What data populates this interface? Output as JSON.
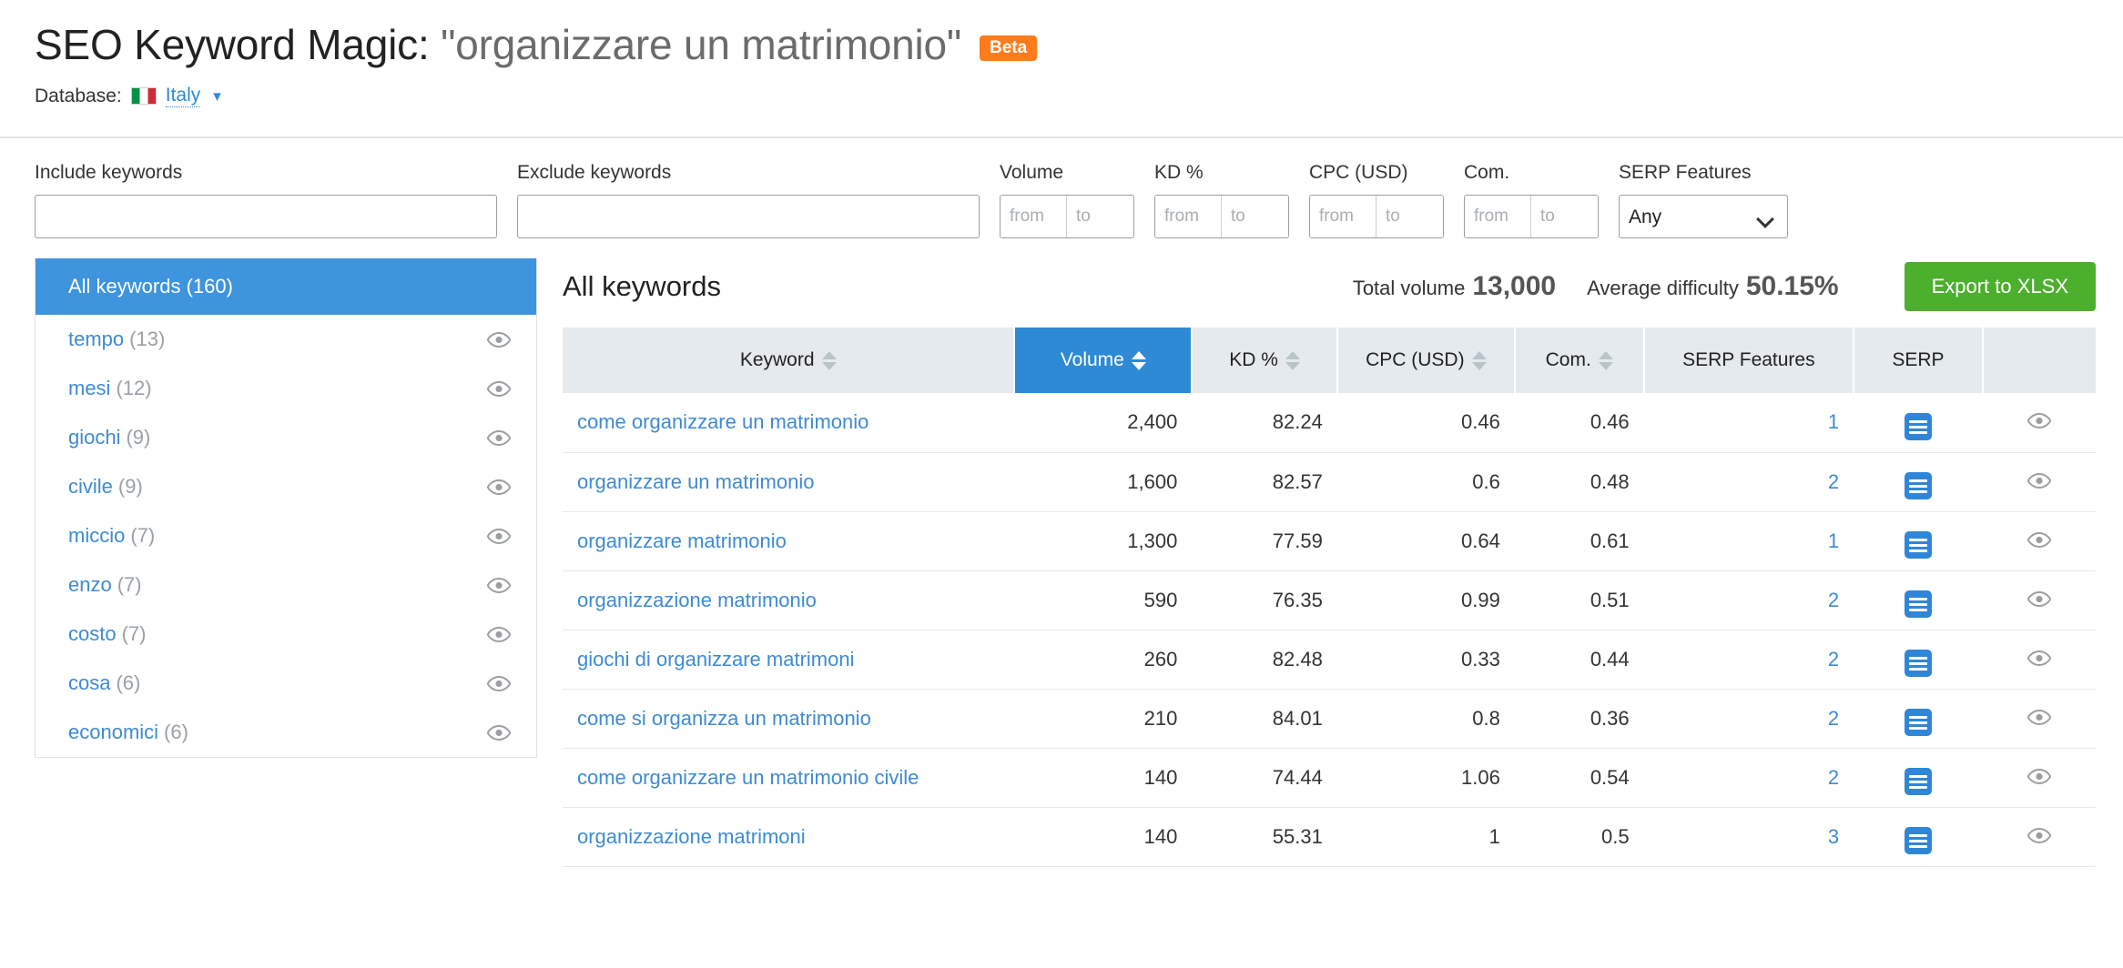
{
  "header": {
    "title_prefix": "SEO Keyword Magic: ",
    "title_query": "\"organizzare un matrimonio\"",
    "beta_label": "Beta",
    "database_label": "Database:",
    "database_value": "Italy",
    "database_flag": "italy-flag-icon",
    "caret_icon": "chevron-down-icon"
  },
  "filters": {
    "include": {
      "label": "Include keywords",
      "value": "",
      "placeholder": ""
    },
    "exclude": {
      "label": "Exclude keywords",
      "value": "",
      "placeholder": ""
    },
    "volume": {
      "label": "Volume",
      "from_placeholder": "from",
      "to_placeholder": "to",
      "from_value": "",
      "to_value": ""
    },
    "kd": {
      "label": "KD %",
      "from_placeholder": "from",
      "to_placeholder": "to",
      "from_value": "",
      "to_value": ""
    },
    "cpc": {
      "label": "CPC (USD)",
      "from_placeholder": "from",
      "to_placeholder": "to",
      "from_value": "",
      "to_value": ""
    },
    "com": {
      "label": "Com.",
      "from_placeholder": "from",
      "to_placeholder": "to",
      "from_value": "",
      "to_value": ""
    },
    "serp_features": {
      "label": "SERP Features",
      "selected": "Any",
      "options": [
        "Any"
      ]
    }
  },
  "sidebar": {
    "all_keywords": {
      "label": "All keywords (160)",
      "selected": true
    },
    "items": [
      {
        "label": "tempo",
        "count": "(13)",
        "eye_icon": "eye-icon"
      },
      {
        "label": "mesi",
        "count": "(12)",
        "eye_icon": "eye-icon"
      },
      {
        "label": "giochi",
        "count": "(9)",
        "eye_icon": "eye-icon"
      },
      {
        "label": "civile",
        "count": "(9)",
        "eye_icon": "eye-icon"
      },
      {
        "label": "miccio",
        "count": "(7)",
        "eye_icon": "eye-icon"
      },
      {
        "label": "enzo",
        "count": "(7)",
        "eye_icon": "eye-icon"
      },
      {
        "label": "costo",
        "count": "(7)",
        "eye_icon": "eye-icon"
      },
      {
        "label": "cosa",
        "count": "(6)",
        "eye_icon": "eye-icon"
      },
      {
        "label": "economici",
        "count": "(6)",
        "eye_icon": "eye-icon"
      }
    ]
  },
  "main": {
    "title": "All keywords",
    "total_volume_label": "Total volume",
    "total_volume_value": "13,000",
    "avg_difficulty_label": "Average difficulty",
    "avg_difficulty_value": "50.15%",
    "export_label": "Export to XLSX",
    "accent_blue": "#2e8ad4",
    "export_green": "#4caf2e",
    "beta_orange": "#ff7b1c"
  },
  "table": {
    "columns": [
      {
        "label": "Keyword",
        "sortable": true,
        "active": false
      },
      {
        "label": "Volume",
        "sortable": true,
        "active": true
      },
      {
        "label": "KD %",
        "sortable": true,
        "active": false
      },
      {
        "label": "CPC (USD)",
        "sortable": true,
        "active": false
      },
      {
        "label": "Com.",
        "sortable": true,
        "active": false
      },
      {
        "label": "SERP Features",
        "sortable": false,
        "active": false
      },
      {
        "label": "SERP",
        "sortable": false,
        "active": false
      },
      {
        "label": "",
        "sortable": false,
        "active": false
      }
    ],
    "rows": [
      {
        "keyword": "come organizzare un matrimonio",
        "volume": "2,400",
        "kd": "82.24",
        "cpc": "0.46",
        "com": "0.46",
        "serp_features": "1",
        "serp_icon": "serp-list-icon",
        "eye_icon": "eye-icon"
      },
      {
        "keyword": "organizzare un matrimonio",
        "volume": "1,600",
        "kd": "82.57",
        "cpc": "0.6",
        "com": "0.48",
        "serp_features": "2",
        "serp_icon": "serp-list-icon",
        "eye_icon": "eye-icon"
      },
      {
        "keyword": "organizzare matrimonio",
        "volume": "1,300",
        "kd": "77.59",
        "cpc": "0.64",
        "com": "0.61",
        "serp_features": "1",
        "serp_icon": "serp-list-icon",
        "eye_icon": "eye-icon"
      },
      {
        "keyword": "organizzazione matrimonio",
        "volume": "590",
        "kd": "76.35",
        "cpc": "0.99",
        "com": "0.51",
        "serp_features": "2",
        "serp_icon": "serp-list-icon",
        "eye_icon": "eye-icon"
      },
      {
        "keyword": "giochi di organizzare matrimoni",
        "volume": "260",
        "kd": "82.48",
        "cpc": "0.33",
        "com": "0.44",
        "serp_features": "2",
        "serp_icon": "serp-list-icon",
        "eye_icon": "eye-icon"
      },
      {
        "keyword": "come si organizza un matrimonio",
        "volume": "210",
        "kd": "84.01",
        "cpc": "0.8",
        "com": "0.36",
        "serp_features": "2",
        "serp_icon": "serp-list-icon",
        "eye_icon": "eye-icon"
      },
      {
        "keyword": "come organizzare un matrimonio civile",
        "volume": "140",
        "kd": "74.44",
        "cpc": "1.06",
        "com": "0.54",
        "serp_features": "2",
        "serp_icon": "serp-list-icon",
        "eye_icon": "eye-icon"
      },
      {
        "keyword": "organizzazione matrimoni",
        "volume": "140",
        "kd": "55.31",
        "cpc": "1",
        "com": "0.5",
        "serp_features": "3",
        "serp_icon": "serp-list-icon",
        "eye_icon": "eye-icon"
      }
    ]
  }
}
